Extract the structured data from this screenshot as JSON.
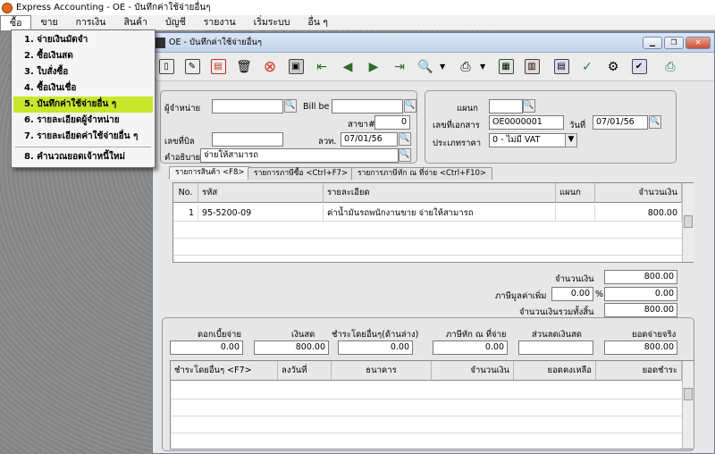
{
  "app": {
    "title": "Express Accounting - OE - บันทึกค่าใช้จ่ายอื่นๆ"
  },
  "menu": [
    "ซื้อ",
    "ขาย",
    "การเงิน",
    "สินค้า",
    "บัญชี",
    "รายงาน",
    "เริ่มระบบ",
    "อื่น ๆ"
  ],
  "dropdown": {
    "items": [
      "1. จ่ายเงินมัดจำ",
      "2. ซื้อเงินสด",
      "3. ใบสั่งซื้อ",
      "4. ซื้อเงินเชื่อ",
      "5. บันทึกค่าใช้จ่ายอื่น ๆ",
      "6. รายละเอียดผู้จำหน่าย",
      "7. รายละเอียดค่าใช้จ่ายอื่น ๆ",
      "8. คำนวณยอดเจ้าหนี้ใหม่"
    ],
    "highlight": "#c8e62a"
  },
  "window": {
    "title": "OE - บันทึกค่าใช้จ่ายอื่นๆ"
  },
  "toolbar": {
    "icons": [
      "new-doc-icon",
      "edit-icon",
      "print-preview-icon",
      "trash-icon",
      "cancel-icon",
      "save-icon",
      "first-icon",
      "prev-icon",
      "next-icon",
      "last-icon",
      "search-icon",
      "printer-icon",
      "note-icon",
      "display-icon",
      "form-icon",
      "ok-green-icon",
      "tools-icon",
      "ok-icon",
      "print-green-icon"
    ]
  },
  "header": {
    "vendor_label": "ผู้จำหน่าย",
    "vendor_value": "",
    "billbe_label": "Bill be",
    "billbe_value": "",
    "branch_label": "สาขา#",
    "branch_value": "0",
    "billno_label": "เลขที่บิล",
    "billno_value": "",
    "billdate_label": "ลวท.",
    "billdate_value": "07/01/56",
    "desc_label": "คำอธิบาย",
    "desc_value": "จ่ายให้สามารถ",
    "dept_label": "แผนก",
    "dept_value": "",
    "docno_label": "เลขที่เอกสาร",
    "docno_value": "OE0000001",
    "date_label": "วันที่",
    "date_value": "07/01/56",
    "pricetype_label": "ประเภทราคา",
    "pricetype_value": "0 - ไม่มี VAT"
  },
  "tabs": [
    "รายการสินค้า <F8>",
    "รายการภาษีซื้อ <Ctrl+F7>",
    "รายการภาษีหัก ณ ที่จ่าย <Ctrl+F10>"
  ],
  "items_grid": {
    "columns": [
      "No.",
      "รหัส",
      "รายละเอียด",
      "แผนก",
      "จำนวนเงิน"
    ],
    "rows": [
      [
        "1",
        "95-5200-09",
        "ค่าน้ำมันรถพนักงานขาย จ่ายให้สามารถ",
        "",
        "800.00"
      ]
    ]
  },
  "totals": {
    "amount_label": "จำนวนเงิน",
    "amount_value": "800.00",
    "vat_label": "ภาษีมูลค่าเพิ่ม",
    "vat_rate": "0.00",
    "vat_pct": "%",
    "vat_value": "0.00",
    "total_label": "จำนวนเงินรวมทั้งสิ้น",
    "total_value": "800.00"
  },
  "payment": {
    "interest_label": "ดอกเบี้ยจ่าย",
    "interest_value": "0.00",
    "cash_label": "เงินสด",
    "cash_value": "800.00",
    "other_label": "ชำระโดยอื่นๆ(ด้านล่าง)",
    "other_value": "0.00",
    "wht_label": "ภาษีหัก ณ ที่จ่าย",
    "wht_value": "0.00",
    "discount_label": "ส่วนลดเงินสด",
    "discount_value": "",
    "net_label": "ยอดจ่ายจริง",
    "net_value": "800.00"
  },
  "pay_grid": {
    "columns": [
      "ชำระโดยอื่นๆ <F7>",
      "ลงวันที่",
      "ธนาคาร",
      "จำนวนเงิน",
      "ยอดคงเหลือ",
      "ยอดชำระ"
    ]
  }
}
